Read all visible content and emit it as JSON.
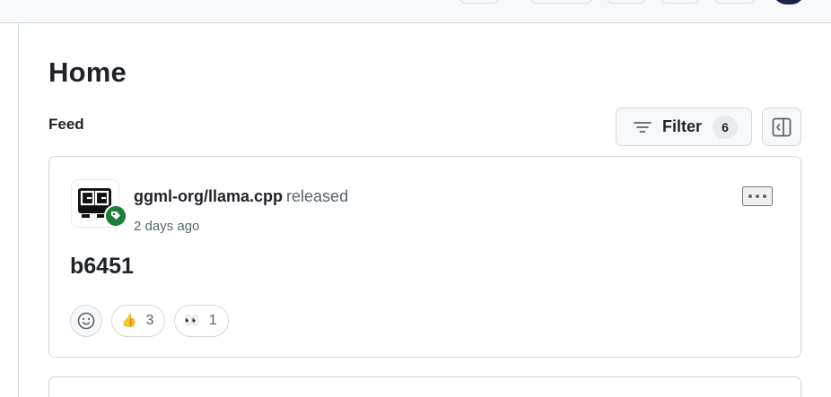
{
  "header": {
    "icons": [
      "toolbar-button",
      "toolbar-button",
      "toolbar-button",
      "toolbar-button",
      "toolbar-button",
      "user-avatar"
    ]
  },
  "page": {
    "title": "Home",
    "section_title": "Feed"
  },
  "filter": {
    "label": "Filter",
    "count": "6",
    "icon": "filter-icon"
  },
  "panel_toggle": {
    "icon": "sidebar-toggle-icon"
  },
  "feed": {
    "items": [
      {
        "repo": "ggml-org/llama.cpp",
        "action": "released",
        "time": "2 days ago",
        "release_name": "b6451",
        "avatar_icon": "ggml-logo-icon",
        "badge_icon": "release-tag-icon",
        "badge_color": "#1a7f37",
        "reactions": [
          {
            "emoji": "👍",
            "icon": "thumbs-up-icon",
            "count": "3"
          },
          {
            "emoji": "👀",
            "icon": "eyes-icon",
            "count": "1"
          }
        ]
      }
    ]
  },
  "colors": {
    "accent": "#1a7f37",
    "border": "#d1d9e0",
    "muted_text": "#59636e",
    "text": "#1f2328"
  }
}
